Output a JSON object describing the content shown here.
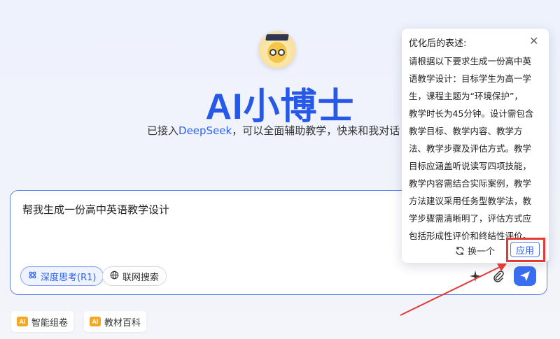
{
  "header": {
    "title": "AI小博士",
    "subtitle_pre": "已接入",
    "subtitle_brand": "DeepSeek",
    "subtitle_post": "，可以全面辅助教学，快来和我对话"
  },
  "input": {
    "text": "帮我生成一份高中英语教学设计",
    "deep_think_label": "深度思考(R1)",
    "web_search_label": "联网搜索"
  },
  "features": [
    {
      "label": "智能组卷",
      "badge": "AI"
    },
    {
      "label": "教材百科",
      "badge": "AI"
    }
  ],
  "popup": {
    "title": "优化后的表述:",
    "lines": [
      "请根据以下要求生成一份高中英",
      "语教学设计：目标学生为高一学",
      "生，课程主题为“环境保护”，",
      "教学时长为45分钟。设计需包含",
      "教学目标、教学内容、教学方",
      "法、教学步骤及评估方式。教学",
      "目标应涵盖听说读写四项技能，",
      "教学内容需结合实际案例，教学",
      "方法建议采用任务型教学法，教",
      "学步骤需清晰明了，评估方式应",
      "包括形成性评价和终结性评价。"
    ],
    "retry_label": "换一个",
    "apply_label": "应用"
  },
  "colors": {
    "accent": "#3a6ef2",
    "title": "#2759e8",
    "highlight": "#e53935"
  }
}
